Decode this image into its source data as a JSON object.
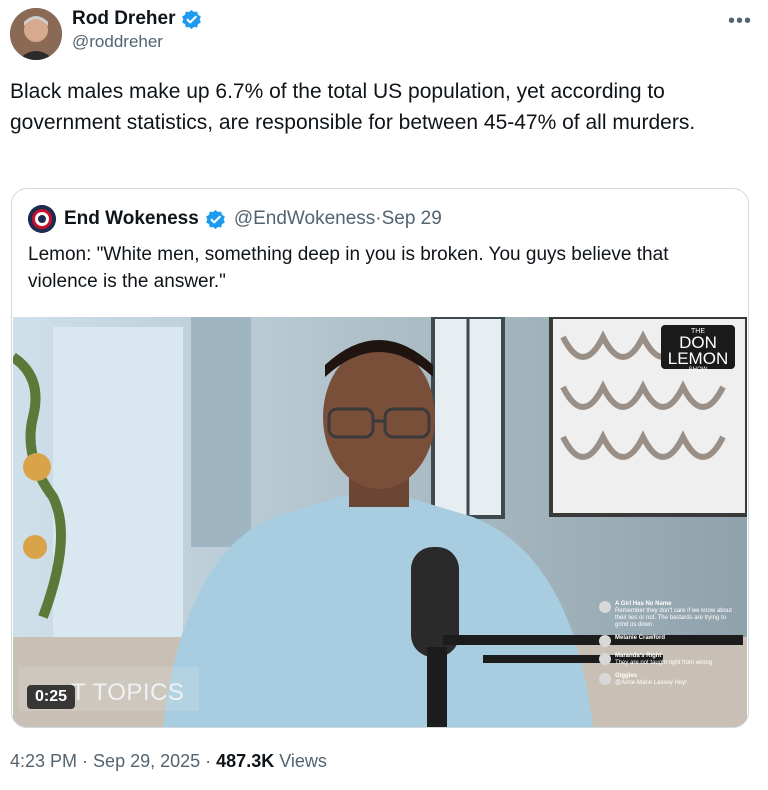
{
  "author": {
    "display_name": "Rod Dreher",
    "handle": "@roddreher",
    "verified": true
  },
  "more_icon": "more-horizontal-icon",
  "tweet_text": "Black males make up 6.7% of the total US population, yet according to government statistics, are responsible for between 45-47% of all murders.",
  "quoted": {
    "display_name": "End Wokeness",
    "handle": "@EndWokeness",
    "separator": " · ",
    "date": "Sep 29",
    "text": "Lemon: \"White men, something deep in you is broken. You guys believe that violence is the answer.\"",
    "video": {
      "duration": "0:25",
      "overlay_text": "T TOPICS",
      "logo_top": "THE",
      "logo_line1": "DON",
      "logo_line2": "LEMON",
      "logo_bottom": "SHOW",
      "chat": [
        {
          "name": "A Girl Has No Name",
          "message": "Remember they don't care if we know about their lies or not. The bastards are trying to grind us down."
        },
        {
          "name": "Melanie Crawford",
          "message": ""
        },
        {
          "name": "Maranda's Right",
          "message": "They are not taught right from wrong"
        },
        {
          "name": "Giggles",
          "message": "@Anne-Marie Lassey Hey!"
        }
      ]
    }
  },
  "footer": {
    "time": "4:23 PM",
    "dot1": " · ",
    "date": "Sep 29, 2025",
    "dot2": " · ",
    "views_count": "487.3K",
    "views_label": " Views"
  },
  "colors": {
    "verified_blue": "#1d9bf0",
    "text_primary": "#0f1419",
    "text_secondary": "#536471",
    "border": "#cfd9de"
  }
}
